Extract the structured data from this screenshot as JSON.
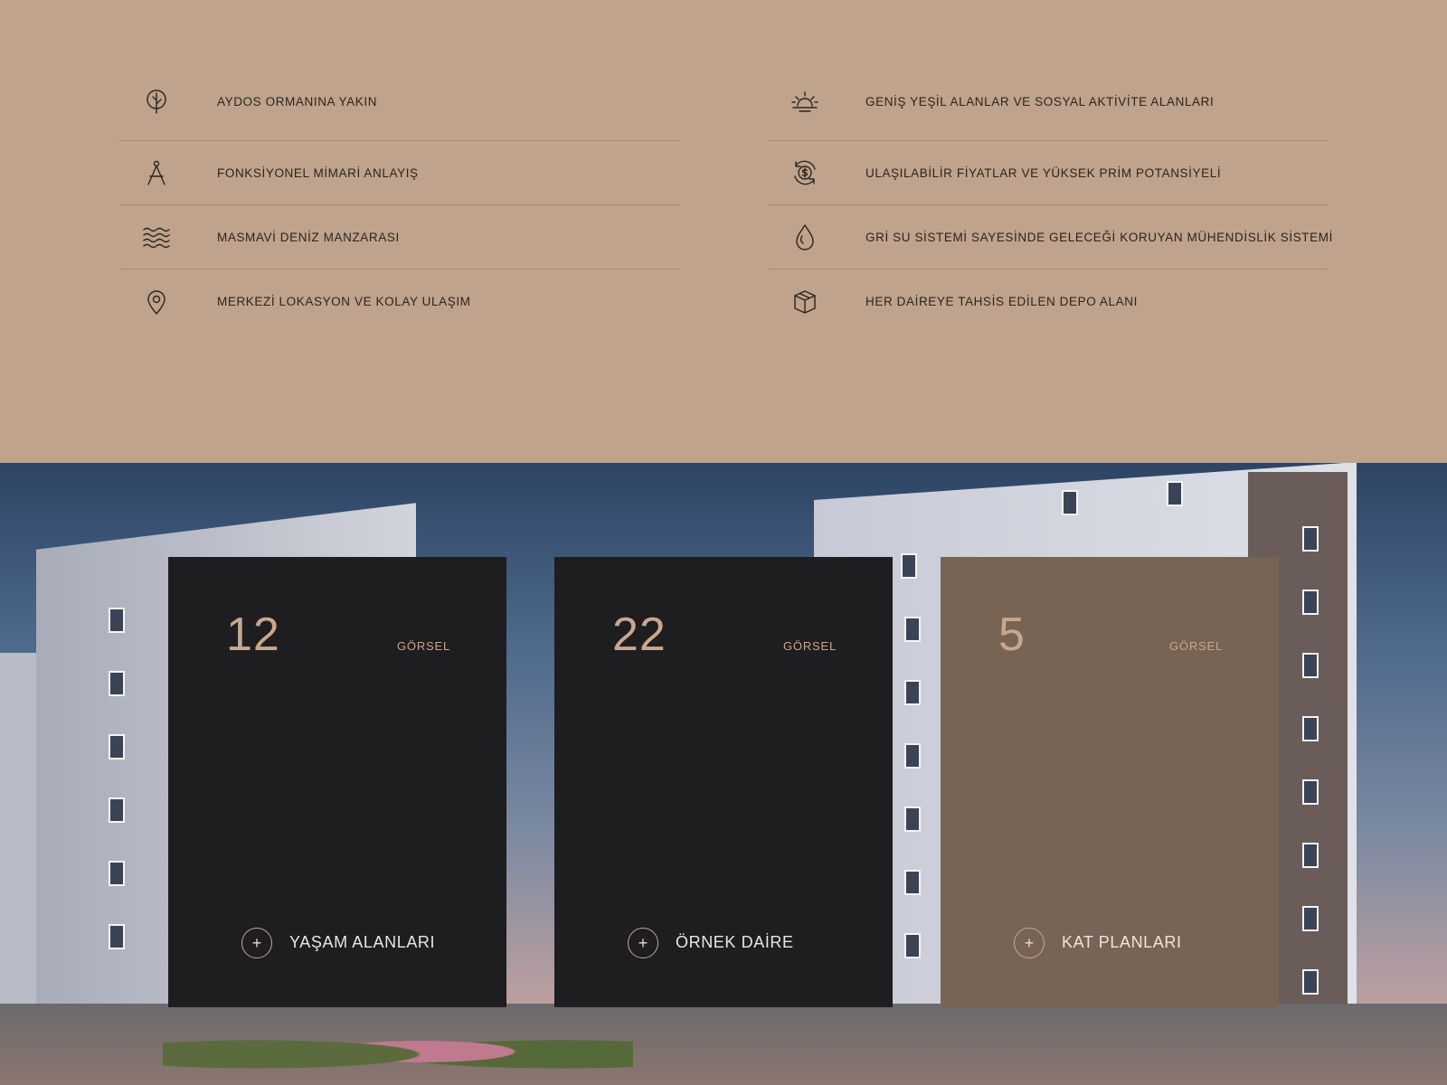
{
  "features": {
    "left": [
      {
        "icon": "tree-icon",
        "label": "AYDOS ORMANINA YAKIN"
      },
      {
        "icon": "compass-icon",
        "label": "FONKSİYONEL MİMARİ ANLAYIŞ"
      },
      {
        "icon": "waves-icon",
        "label": "MASMAVİ DENİZ MANZARASI"
      },
      {
        "icon": "location-pin-icon",
        "label": "MERKEZİ LOKASYON VE KOLAY ULAŞIM"
      }
    ],
    "right": [
      {
        "icon": "sunrise-icon",
        "label": "GENİŞ YEŞİL ALANLAR VE SOSYAL AKTİVİTE ALANLARI"
      },
      {
        "icon": "dollar-cycle-icon",
        "label": "ULAŞILABİLİR FİYATLAR VE YÜKSEK PRİM POTANSİYELİ"
      },
      {
        "icon": "water-drop-icon",
        "label": "GRİ SU SİSTEMİ SAYESİNDE GELECEĞİ KORUYAN MÜHENDİSLİK SİSTEMİ"
      },
      {
        "icon": "box-icon",
        "label": "HER DAİREYE TAHSİS EDİLEN DEPO ALANI"
      }
    ]
  },
  "gallery": {
    "cards": [
      {
        "count": "12",
        "unit": "GÖRSEL",
        "plus": "+",
        "label": "YAŞAM ALANLARI"
      },
      {
        "count": "22",
        "unit": "GÖRSEL",
        "plus": "+",
        "label": "ÖRNEK DAİRE"
      },
      {
        "count": "5",
        "unit": "GÖRSEL",
        "plus": "+",
        "label": "KAT PLANLARI"
      }
    ]
  },
  "colors": {
    "section_bg": "#bfa38c",
    "card_dark": "#1e1d20",
    "card_brown": "#786455",
    "accent": "#c8a78f"
  }
}
